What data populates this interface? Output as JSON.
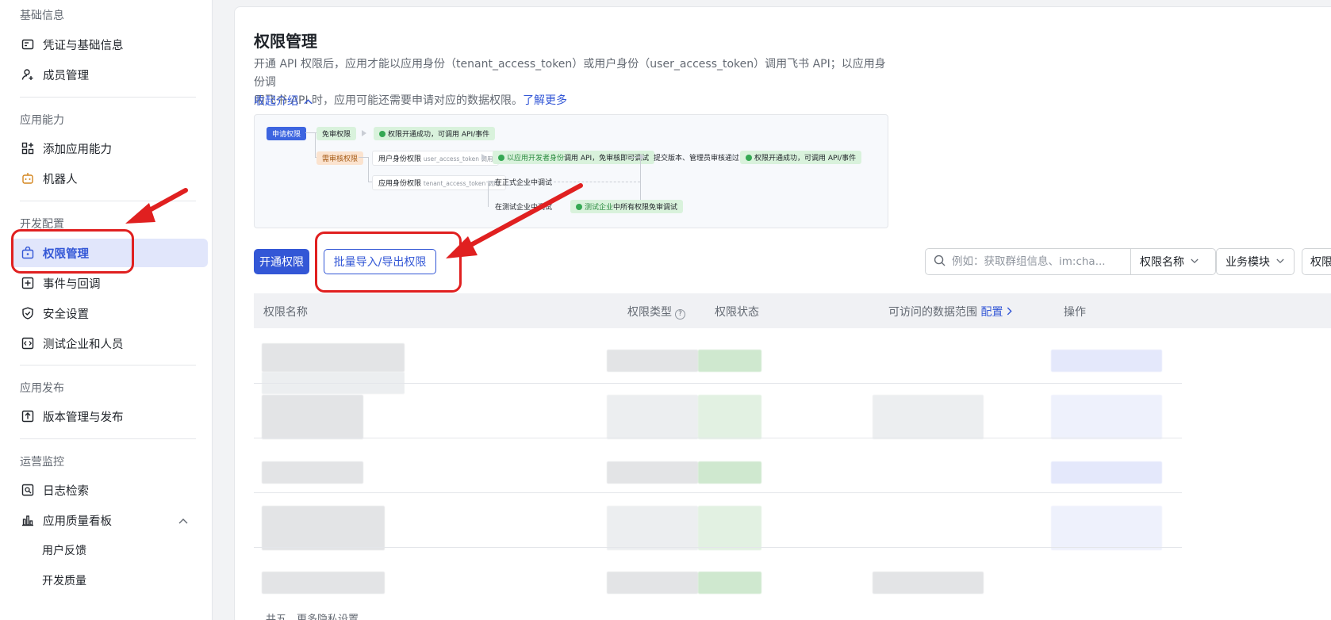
{
  "sidebar": {
    "sections": [
      {
        "label": "基础信息"
      },
      {
        "label": "应用能力"
      },
      {
        "label": "开发配置"
      },
      {
        "label": "应用发布"
      },
      {
        "label": "运营监控"
      }
    ],
    "items": {
      "credentials": "凭证与基础信息",
      "members": "成员管理",
      "add_capability": "添加应用能力",
      "robot": "机器人",
      "permissions": "权限管理",
      "events": "事件与回调",
      "security": "安全设置",
      "test_enterprise": "测试企业和人员",
      "version": "版本管理与发布",
      "logs": "日志检索",
      "quality_board": "应用质量看板",
      "user_feedback": "用户反馈",
      "dev_quality": "开发质量"
    },
    "accent": "#3357d6"
  },
  "main": {
    "title": "权限管理",
    "desc_line1": "开通 API 权限后，应用才能以应用身份（tenant_access_token）或用户身份（user_access_token）调用飞书 API；以应用身份调",
    "desc_line2": "用飞书 API 时，应用可能还需要申请对应的数据权限。",
    "learn_more": "了解更多",
    "collapse": "收起介绍"
  },
  "flow": {
    "apply": "申请权限",
    "no_review": "免审权限",
    "success1": "权限开通成功，可调用 API/事件",
    "need_review": "需审核权限",
    "user_identity": "用户身份权限",
    "user_token": "user_access_token 调用",
    "dev_identity_a": "以应用开发者身份",
    "dev_identity_b": "调用 API，免审核即可调试",
    "submit": "提交版本、管理员审核通过",
    "success2": "权限开通成功，可调用 API/事件",
    "app_identity": "应用身份权限",
    "tenant_token": "tenant_access_token 调用",
    "formal_debug": "在正式企业中调试",
    "test_debug": "在测试企业中调试",
    "test_ent_a": "测试企业",
    "test_ent_b": "中所有权限免审调试"
  },
  "toolbar": {
    "open_permission": "开通权限",
    "batch_import_export": "批量导入/导出权限",
    "search_placeholder": "例如：获取群组信息、im:cha...",
    "filter_name": "权限名称",
    "filter_module": "业务模块",
    "filter_more": "权限"
  },
  "table": {
    "headers": {
      "name": "权限名称",
      "type": "权限类型",
      "status": "权限状态",
      "scope": "可访问的数据范围",
      "scope_link": "配置",
      "actions": "操作"
    }
  },
  "footer": "共五、更多隐私设置"
}
